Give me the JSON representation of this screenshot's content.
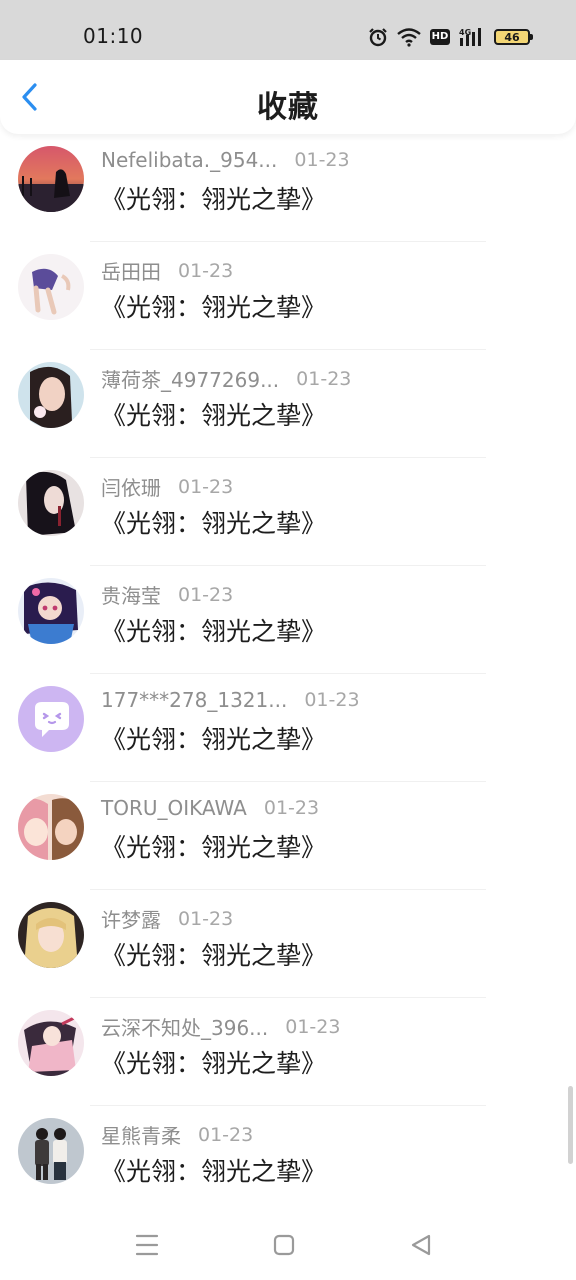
{
  "status_bar": {
    "time": "01:10",
    "hd_label": "HD",
    "battery_level": "46"
  },
  "header": {
    "back_icon": "chevron-left-icon",
    "title": "收藏",
    "accent_color": "#2b8ef0"
  },
  "favorites": [
    {
      "user": "Nefelibata._954...",
      "date": "01-23",
      "book": "《光翎：翎光之挚》",
      "avatar": "sunset-silhouette"
    },
    {
      "user": "岳田田",
      "date": "01-23",
      "book": "《光翎：翎光之挚》",
      "avatar": "anime-girl-skirt"
    },
    {
      "user": "薄荷茶_4977269...",
      "date": "01-23",
      "book": "《光翎：翎光之挚》",
      "avatar": "girl-portrait"
    },
    {
      "user": "闫依珊",
      "date": "01-23",
      "book": "《光翎：翎光之挚》",
      "avatar": "dark-hair-figure"
    },
    {
      "user": "贵海莹",
      "date": "01-23",
      "book": "《光翎：翎光之挚》",
      "avatar": "anime-character-colorful"
    },
    {
      "user": "177***278_1321...",
      "date": "01-23",
      "book": "《光翎：翎光之挚》",
      "avatar": "default-chat-bubble"
    },
    {
      "user": "TORU_OIKAWA",
      "date": "01-23",
      "book": "《光翎：翎光之挚》",
      "avatar": "anime-duo"
    },
    {
      "user": "许梦露",
      "date": "01-23",
      "book": "《光翎：翎光之挚》",
      "avatar": "blonde-girl"
    },
    {
      "user": "云深不知处_396...",
      "date": "01-23",
      "book": "《光翎：翎光之挚》",
      "avatar": "pink-anime-figure"
    },
    {
      "user": "星熊青柔",
      "date": "01-23",
      "book": "《光翎：翎光之挚》",
      "avatar": "couple-photo"
    }
  ],
  "nav_bar": {
    "menu_icon": "menu-icon",
    "home_icon": "home-square-icon",
    "back_icon": "back-triangle-icon"
  }
}
